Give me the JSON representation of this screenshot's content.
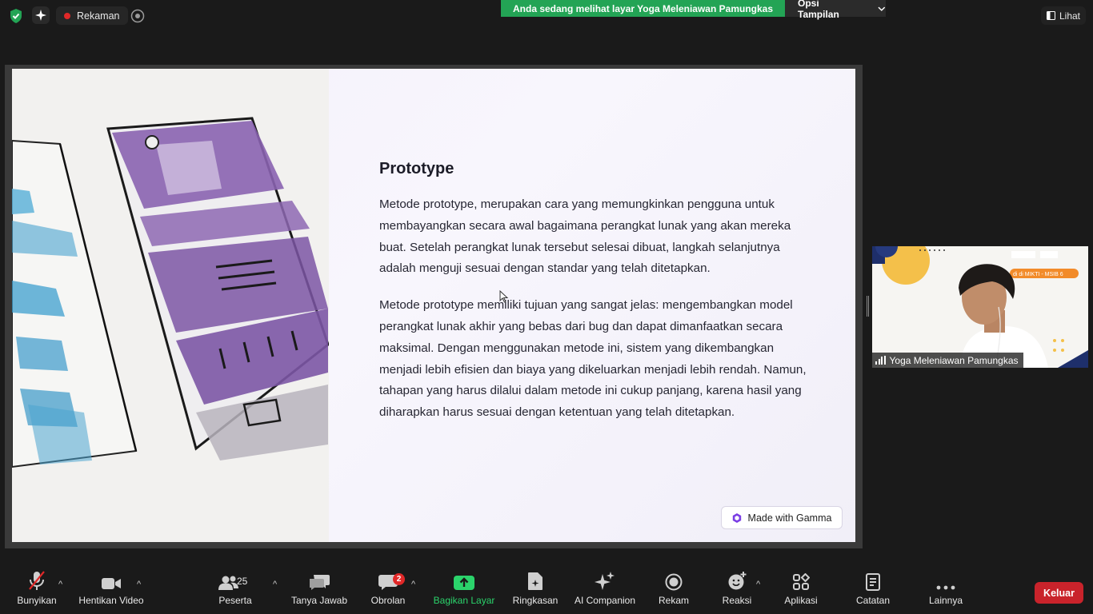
{
  "topbar": {
    "recording_label": "Rekaman",
    "viewing_banner": "Anda sedang melihat layar Yoga Meleniawan Pamungkas",
    "view_options_label": "Opsi Tampilan",
    "view_label": "Lihat"
  },
  "slide": {
    "title": "Prototype",
    "paragraphs": [
      "Metode prototype, merupakan cara yang memungkinkan pengguna untuk membayangkan secara awal bagaimana perangkat lunak yang akan mereka buat. Setelah perangkat lunak tersebut selesai dibuat, langkah selanjutnya adalah menguji sesuai dengan standar yang telah ditetapkan.",
      "Metode prototype memiliki tujuan yang sangat jelas: mengembangkan model perangkat lunak akhir yang bebas dari bug dan dapat dimanfaatkan secara maksimal. Dengan menggunakan metode ini, sistem yang dikembangkan menjadi lebih efisien dan biaya yang dikeluarkan menjadi lebih rendah. Namun, tahapan yang harus dilalui dalam metode ini cukup panjang, karena hasil yang diharapkan harus sesuai dengan ketentuan yang telah ditetapkan."
    ],
    "badge_label": "Made with Gamma"
  },
  "video": {
    "participant_name": "Yoga Meleniawan Pamungkas",
    "background_text": "di di MIKTI - MSIB 6"
  },
  "toolbar": {
    "unmute": "Bunyikan",
    "stop_video": "Hentikan Video",
    "participants": "Peserta",
    "participants_count": "25",
    "qa": "Tanya Jawab",
    "chat": "Obrolan",
    "chat_badge": "2",
    "share": "Bagikan Layar",
    "summary": "Ringkasan",
    "ai": "AI Companion",
    "record": "Rekam",
    "reactions": "Reaksi",
    "apps": "Aplikasi",
    "notes": "Catatan",
    "more": "Lainnya",
    "leave": "Keluar"
  },
  "colors": {
    "banner_green": "#23a455",
    "share_green": "#2bd36b",
    "leave_red": "#c9232b",
    "badge_red": "#e02828"
  }
}
